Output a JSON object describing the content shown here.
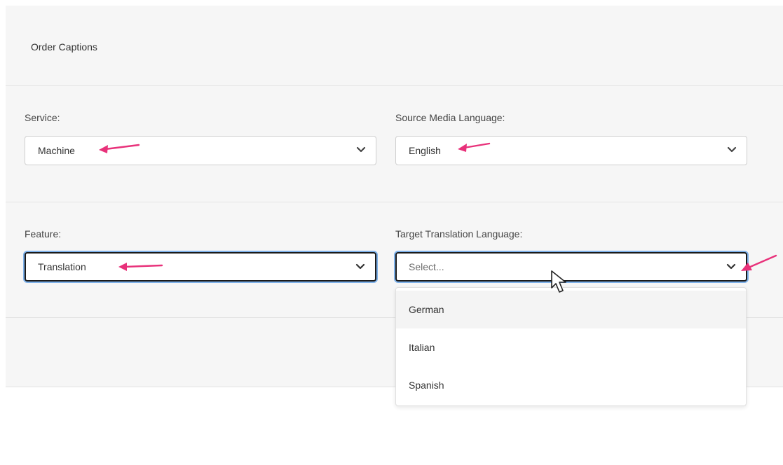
{
  "panel": {
    "title": "Order Captions"
  },
  "fields": {
    "service": {
      "label": "Service:",
      "value": "Machine"
    },
    "source_language": {
      "label": "Source Media Language:",
      "value": "English"
    },
    "feature": {
      "label": "Feature:",
      "value": "Translation"
    },
    "target_language": {
      "label": "Target Translation Language:",
      "placeholder": "Select...",
      "options": [
        "German",
        "Italian",
        "Spanish"
      ]
    }
  },
  "icons": {
    "chevron": "chevron-down-icon",
    "annotation_arrow": "arrow-left-icon",
    "cursor": "mouse-pointer-icon"
  },
  "colors": {
    "annotation_arrow": "#e8317a",
    "focus_ring": "#7fb2ea",
    "panel_background": "#f6f6f6"
  }
}
